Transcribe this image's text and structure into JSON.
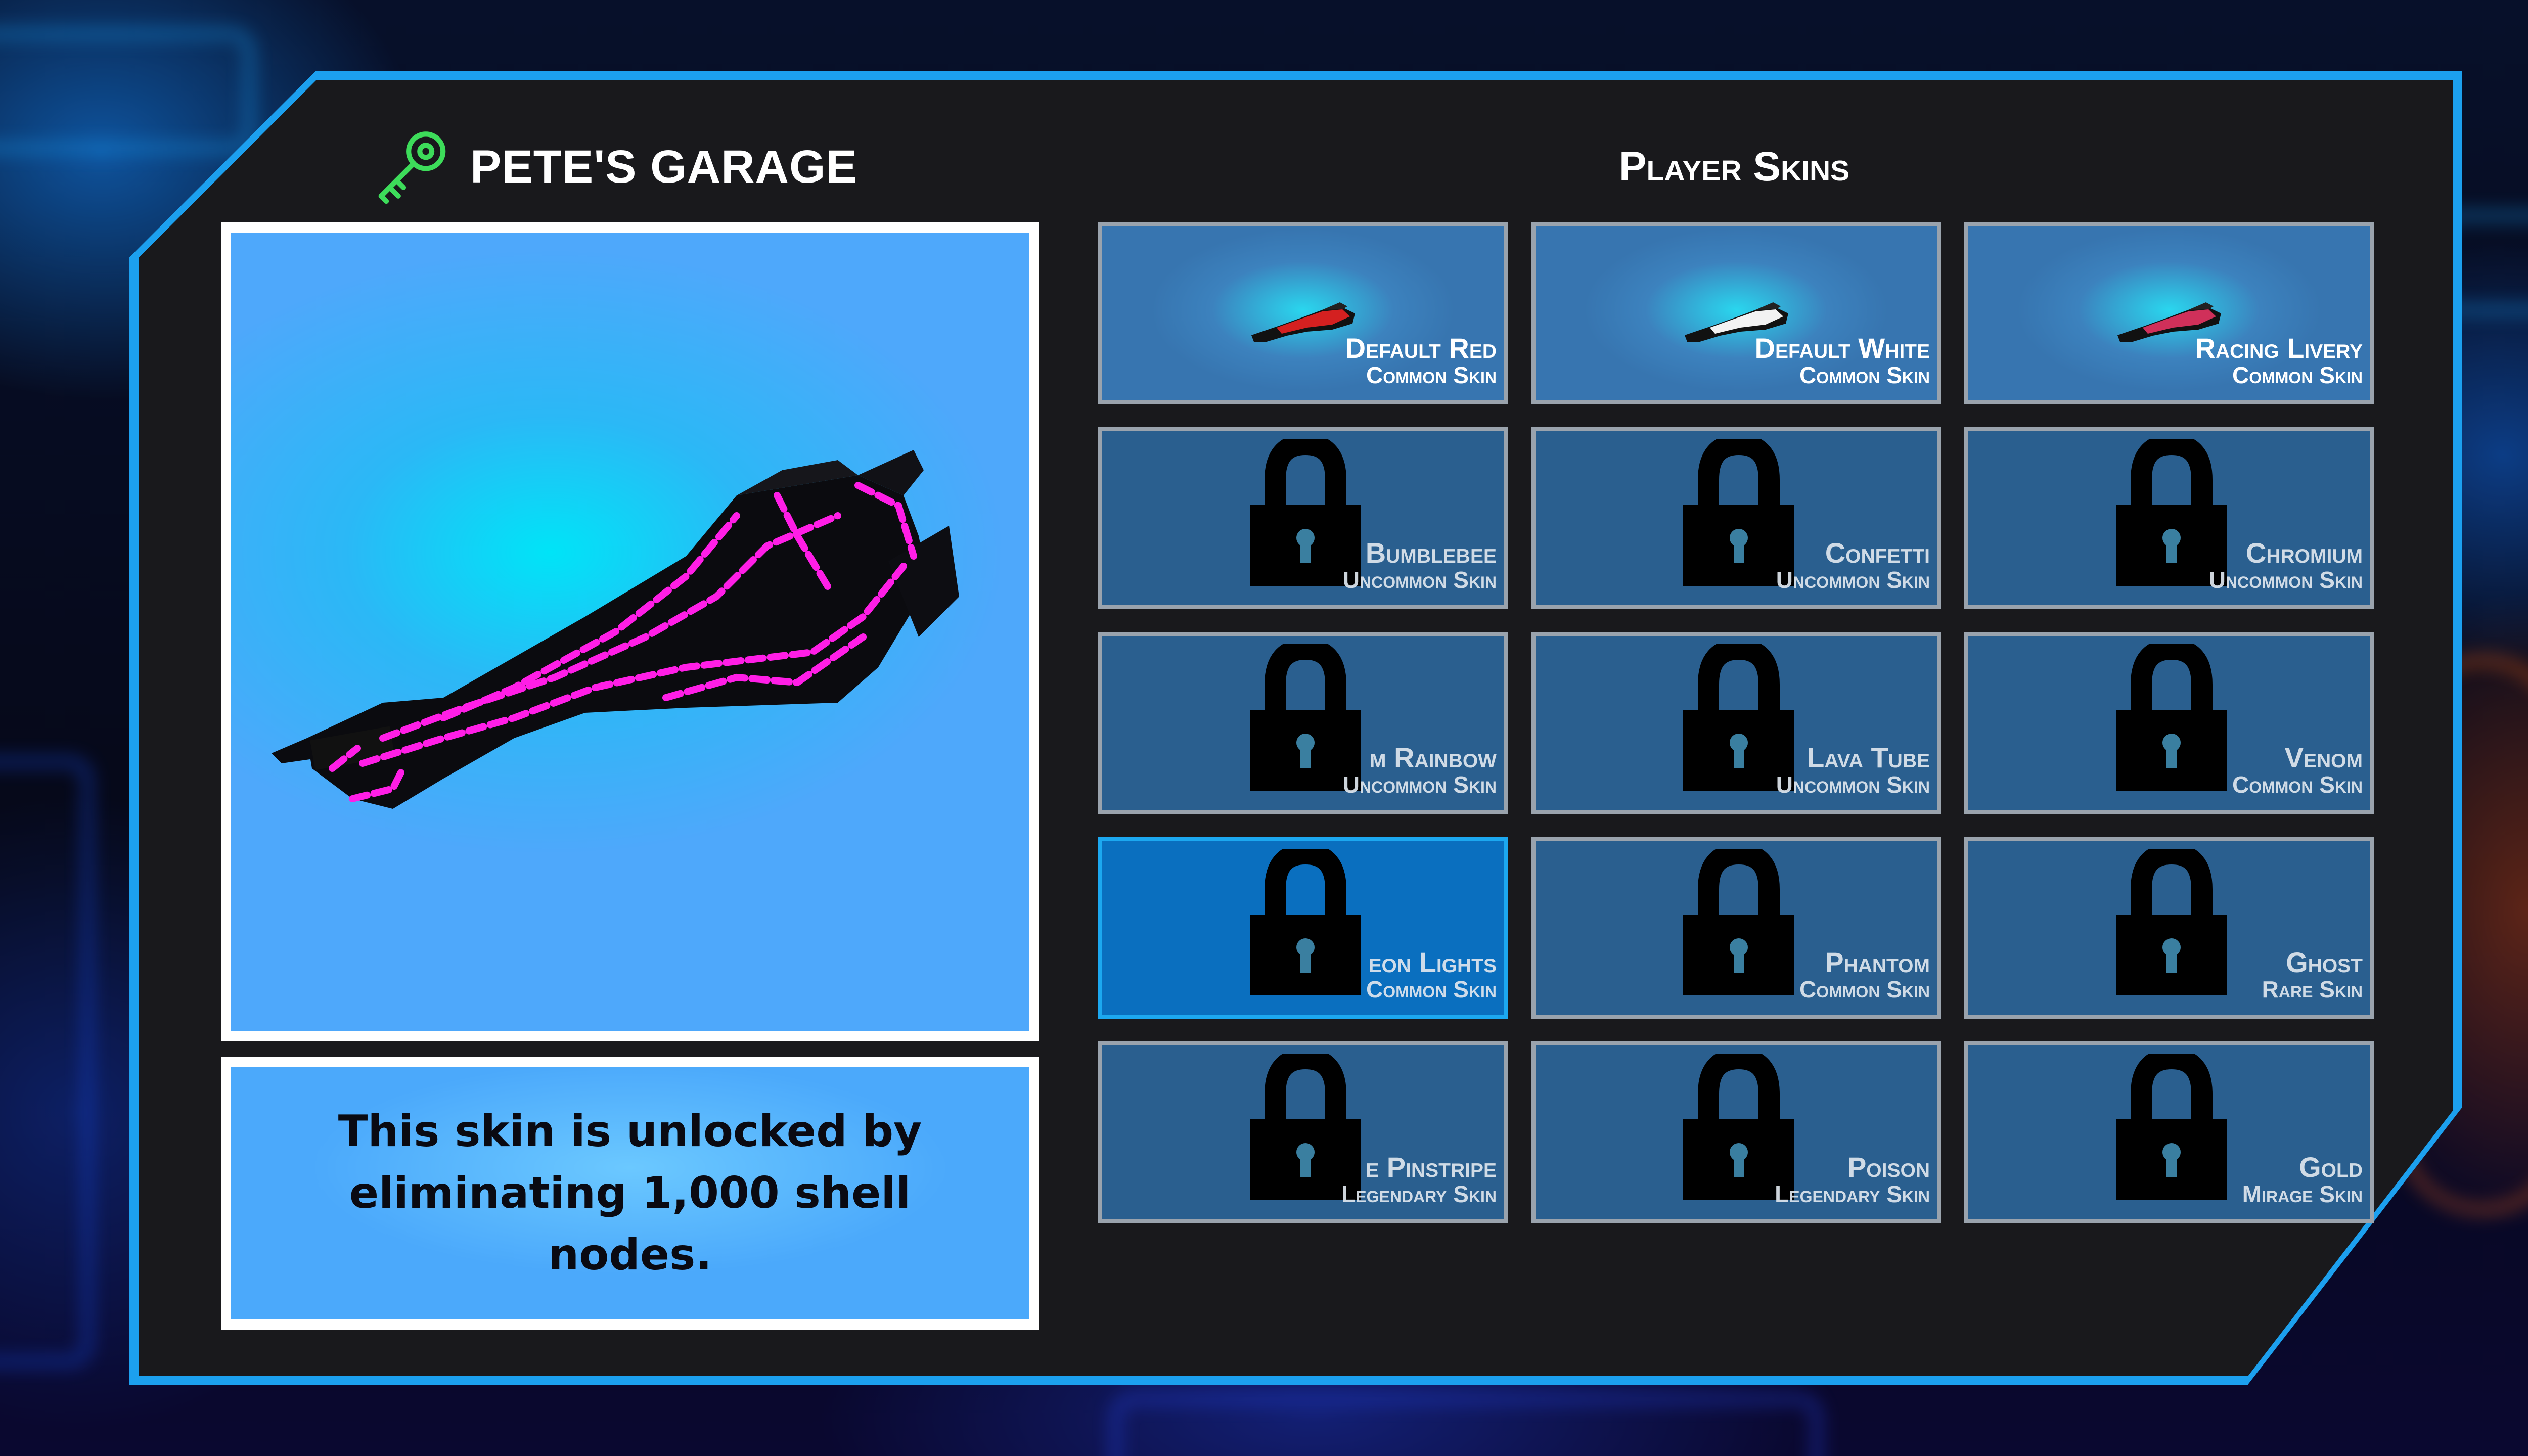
{
  "garage": {
    "title": "PETE'S GARAGE",
    "description": "This skin is unlocked by eliminating 1,000 shell nodes."
  },
  "skins_panel": {
    "title": "Player Skins",
    "skins": [
      {
        "name": "Default Red",
        "rarity": "Common Skin",
        "state": "unlocked",
        "ship_color": "#d42020"
      },
      {
        "name": "Default White",
        "rarity": "Common Skin",
        "state": "unlocked",
        "ship_color": "#f2f2f2"
      },
      {
        "name": "Racing Livery",
        "rarity": "Common Skin",
        "state": "unlocked",
        "ship_color": "#d0305a"
      },
      {
        "name": "Bumblebee",
        "rarity": "Uncommon Skin",
        "state": "locked"
      },
      {
        "name": "Confetti",
        "rarity": "Uncommon Skin",
        "state": "locked"
      },
      {
        "name": "Chromium",
        "rarity": "Uncommon Skin",
        "state": "locked"
      },
      {
        "name": "m Rainbow",
        "rarity": "Uncommon Skin",
        "state": "locked"
      },
      {
        "name": "Lava Tube",
        "rarity": "Uncommon Skin",
        "state": "locked"
      },
      {
        "name": "Venom",
        "rarity": "Common Skin",
        "state": "locked"
      },
      {
        "name": "eon Lights",
        "rarity": "Common Skin",
        "state": "locked",
        "selected": true
      },
      {
        "name": "Phantom",
        "rarity": "Common Skin",
        "state": "locked"
      },
      {
        "name": "Ghost",
        "rarity": "Rare Skin",
        "state": "locked"
      },
      {
        "name": "e Pinstripe",
        "rarity": "Legendary Skin",
        "state": "locked"
      },
      {
        "name": "Poison",
        "rarity": "Legendary Skin",
        "state": "locked"
      },
      {
        "name": "Gold",
        "rarity": "Mirage Skin",
        "state": "locked"
      }
    ]
  },
  "colors": {
    "panel_border": "#1ca0ef",
    "panel_bg": "#19191c",
    "key_icon": "#3ddc5a",
    "preview_accent": "#ff1ee6",
    "tile_bg": "#2a5f8f",
    "tile_selected": "#0a6fbf"
  },
  "icons": {
    "header": "key-icon",
    "locked_tile": "padlock-icon"
  }
}
